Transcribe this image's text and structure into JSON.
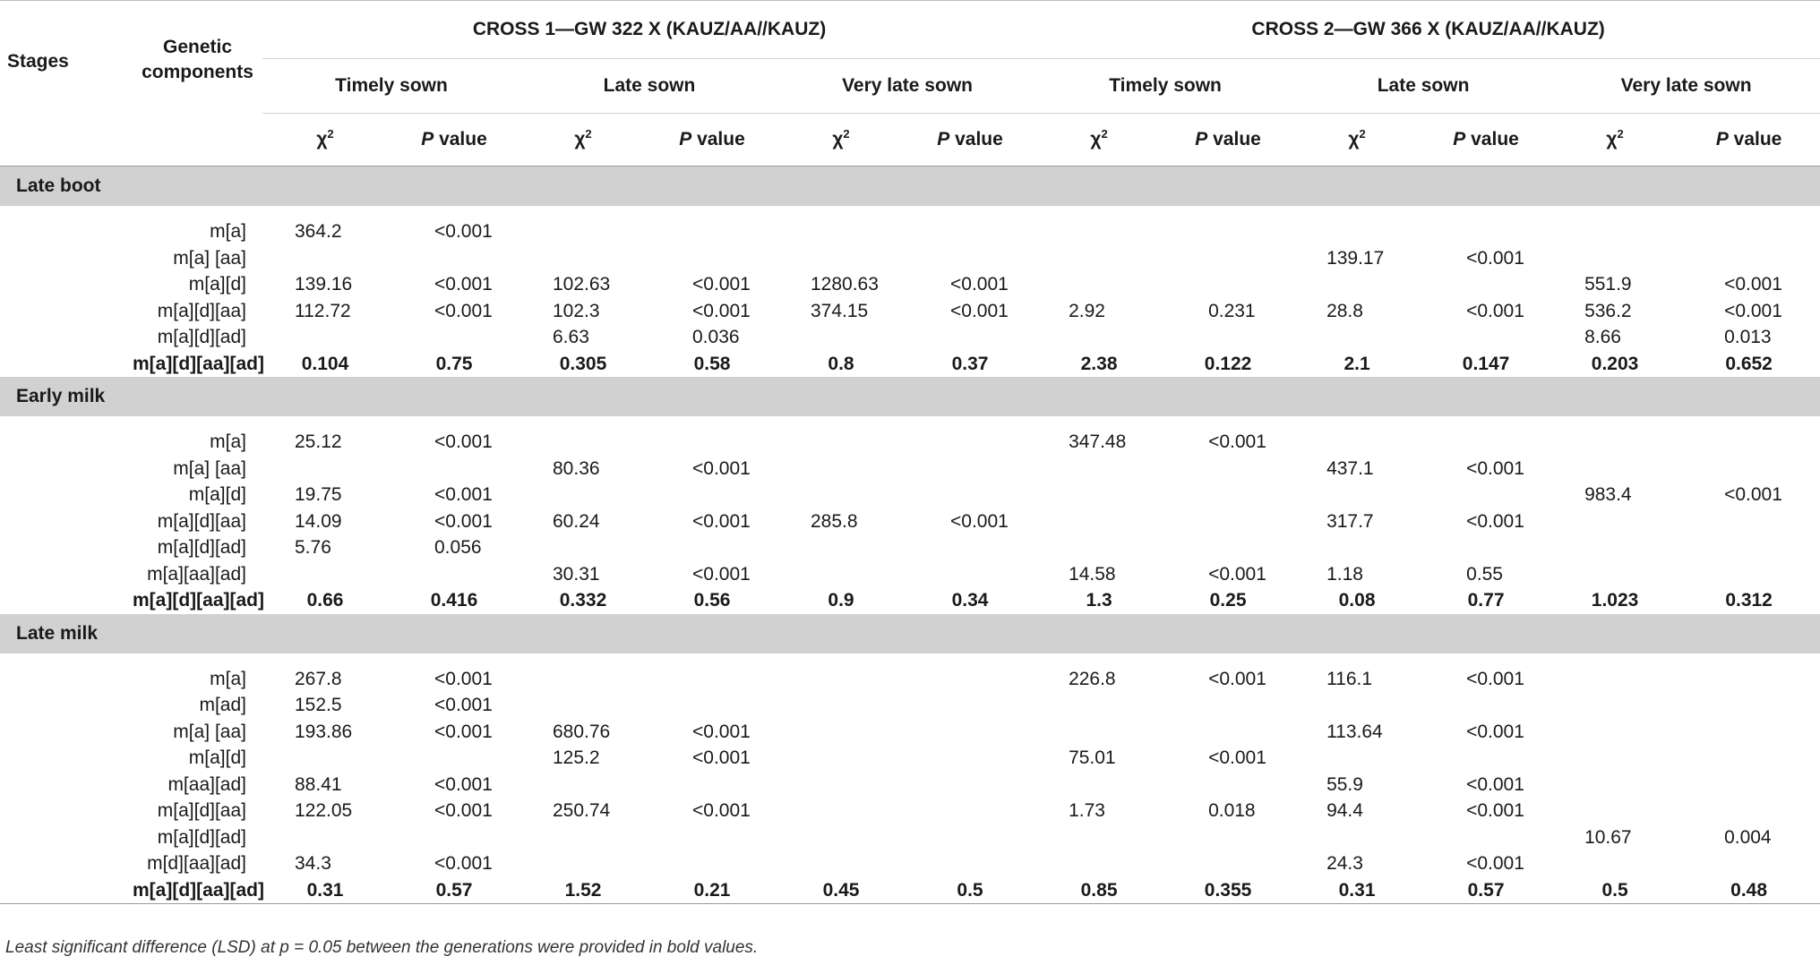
{
  "header": {
    "stages": "Stages",
    "genetic_components_1": "Genetic",
    "genetic_components_2": "components",
    "cross1": "CROSS 1—GW 322 X (KAUZ/AA//KAUZ)",
    "cross2": "CROSS 2—GW 366 X (KAUZ/AA//KAUZ)",
    "conditions": [
      "Timely sown",
      "Late sown",
      "Very late sown",
      "Timely sown",
      "Late sown",
      "Very late sown"
    ],
    "chi_base": "χ",
    "chi_sup": "2",
    "p_italic": "P",
    "p_rest": " value"
  },
  "sections": [
    {
      "stage": "Late boot",
      "rows": [
        {
          "comp": "m[a]",
          "v": [
            "364.2",
            "<0.001",
            "",
            "",
            "",
            "",
            "",
            "",
            "",
            "",
            "",
            ""
          ]
        },
        {
          "comp": "m[a] [aa]",
          "v": [
            "",
            "",
            "",
            "",
            "",
            "",
            "",
            "",
            "139.17",
            "<0.001",
            "",
            ""
          ]
        },
        {
          "comp": "m[a][d]",
          "v": [
            "139.16",
            "<0.001",
            "102.63",
            "<0.001",
            "1280.63",
            "<0.001",
            "",
            "",
            "",
            "",
            "551.9",
            "<0.001"
          ]
        },
        {
          "comp": "m[a][d][aa]",
          "v": [
            "112.72",
            "<0.001",
            "102.3",
            "<0.001",
            "374.15",
            "<0.001",
            "2.92",
            "0.231",
            "28.8",
            "<0.001",
            "536.2",
            "<0.001"
          ]
        },
        {
          "comp": "m[a][d][ad]",
          "v": [
            "",
            "",
            "6.63",
            "0.036",
            "",
            "",
            "",
            "",
            "",
            "",
            "8.66",
            "0.013"
          ]
        },
        {
          "comp": "m[a][d][aa][ad]",
          "bold": true,
          "v": [
            "0.104",
            "0.75",
            "0.305",
            "0.58",
            "0.8",
            "0.37",
            "2.38",
            "0.122",
            "2.1",
            "0.147",
            "0.203",
            "0.652"
          ]
        }
      ]
    },
    {
      "stage": "Early milk",
      "rows": [
        {
          "comp": "m[a]",
          "v": [
            "25.12",
            "<0.001",
            "",
            "",
            "",
            "",
            "347.48",
            "<0.001",
            "",
            "",
            "",
            ""
          ]
        },
        {
          "comp": "m[a] [aa]",
          "v": [
            "",
            "",
            "80.36",
            "<0.001",
            "",
            "",
            "",
            "",
            "437.1",
            "<0.001",
            "",
            ""
          ]
        },
        {
          "comp": "m[a][d]",
          "v": [
            "19.75",
            "<0.001",
            "",
            "",
            "",
            "",
            "",
            "",
            "",
            "",
            "983.4",
            "<0.001"
          ]
        },
        {
          "comp": "m[a][d][aa]",
          "v": [
            "14.09",
            "<0.001",
            "60.24",
            "<0.001",
            "285.8",
            "<0.001",
            "",
            "",
            "317.7",
            "<0.001",
            "",
            ""
          ]
        },
        {
          "comp": "m[a][d][ad]",
          "v": [
            "5.76",
            "0.056",
            "",
            "",
            "",
            "",
            "",
            "",
            "",
            "",
            "",
            ""
          ]
        },
        {
          "comp": "m[a][aa][ad]",
          "v": [
            "",
            "",
            "30.31",
            "<0.001",
            "",
            "",
            "14.58",
            "<0.001",
            "1.18",
            "0.55",
            "",
            ""
          ]
        },
        {
          "comp": "m[a][d][aa][ad]",
          "bold": true,
          "v": [
            "0.66",
            "0.416",
            "0.332",
            "0.56",
            "0.9",
            "0.34",
            "1.3",
            "0.25",
            "0.08",
            "0.77",
            "1.023",
            "0.312"
          ]
        }
      ]
    },
    {
      "stage": "Late milk",
      "rows": [
        {
          "comp": "m[a]",
          "v": [
            "267.8",
            "<0.001",
            "",
            "",
            "",
            "",
            "226.8",
            "<0.001",
            "116.1",
            "<0.001",
            "",
            ""
          ]
        },
        {
          "comp": "m[ad]",
          "v": [
            "152.5",
            "<0.001",
            "",
            "",
            "",
            "",
            "",
            "",
            "",
            "",
            "",
            ""
          ]
        },
        {
          "comp": "m[a] [aa]",
          "v": [
            "193.86",
            "<0.001",
            "680.76",
            "<0.001",
            "",
            "",
            "",
            "",
            "113.64",
            "<0.001",
            "",
            ""
          ]
        },
        {
          "comp": "m[a][d]",
          "v": [
            "",
            "",
            "125.2",
            "<0.001",
            "",
            "",
            "75.01",
            "<0.001",
            "",
            "",
            "",
            ""
          ]
        },
        {
          "comp": "m[aa][ad]",
          "v": [
            "88.41",
            "<0.001",
            "",
            "",
            "",
            "",
            "",
            "",
            "55.9",
            "<0.001",
            "",
            ""
          ]
        },
        {
          "comp": "m[a][d][aa]",
          "v": [
            "122.05",
            "<0.001",
            "250.74",
            "<0.001",
            "",
            "",
            "1.73",
            "0.018",
            "94.4",
            "<0.001",
            "",
            ""
          ]
        },
        {
          "comp": "m[a][d][ad]",
          "v": [
            "",
            "",
            "",
            "",
            "",
            "",
            "",
            "",
            "",
            "",
            "10.67",
            "0.004"
          ]
        },
        {
          "comp": "m[d][aa][ad]",
          "v": [
            "34.3",
            "<0.001",
            "",
            "",
            "",
            "",
            "",
            "",
            "24.3",
            "<0.001",
            "",
            ""
          ]
        },
        {
          "comp": "m[a][d][aa][ad]",
          "bold": true,
          "v": [
            "0.31",
            "0.57",
            "1.52",
            "0.21",
            "0.45",
            "0.5",
            "0.85",
            "0.355",
            "0.31",
            "0.57",
            "0.5",
            "0.48"
          ]
        }
      ]
    }
  ],
  "footnote": "Least significant difference (LSD) at p = 0.05 between the generations were provided in bold values."
}
